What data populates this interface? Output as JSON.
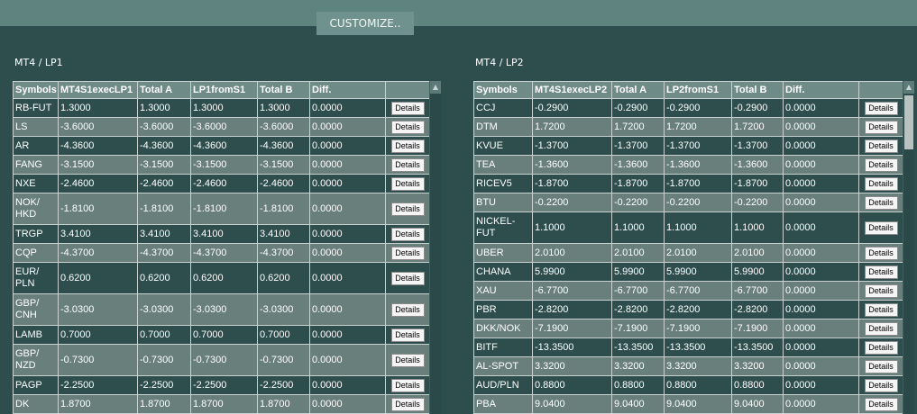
{
  "customize_label": "CUSTOMIZE..",
  "panels": [
    {
      "title": "MT4 / LP1",
      "headers": [
        "Symbols",
        "MT4S1execLP1",
        "Total A",
        "LP1fromS1",
        "Total B",
        "Diff."
      ],
      "button_label": "Details",
      "rows": [
        {
          "symbol": "RB-FUT",
          "exec": "1.3000",
          "total_a": "1.3000",
          "from": "1.3000",
          "total_b": "1.3000",
          "diff": "0.0000"
        },
        {
          "symbol": "LS",
          "exec": "-3.6000",
          "total_a": "-3.6000",
          "from": "-3.6000",
          "total_b": "-3.6000",
          "diff": "0.0000"
        },
        {
          "symbol": "AR",
          "exec": "-4.3600",
          "total_a": "-4.3600",
          "from": "-4.3600",
          "total_b": "-4.3600",
          "diff": "0.0000"
        },
        {
          "symbol": "FANG",
          "exec": "-3.1500",
          "total_a": "-3.1500",
          "from": "-3.1500",
          "total_b": "-3.1500",
          "diff": "0.0000"
        },
        {
          "symbol": "NXE",
          "exec": "-2.4600",
          "total_a": "-2.4600",
          "from": "-2.4600",
          "total_b": "-2.4600",
          "diff": "0.0000"
        },
        {
          "symbol": "NOK/ HKD",
          "exec": "-1.8100",
          "total_a": "-1.8100",
          "from": "-1.8100",
          "total_b": "-1.8100",
          "diff": "0.0000",
          "tall": true
        },
        {
          "symbol": "TRGP",
          "exec": "3.4100",
          "total_a": "3.4100",
          "from": "3.4100",
          "total_b": "3.4100",
          "diff": "0.0000"
        },
        {
          "symbol": "CQP",
          "exec": "-4.3700",
          "total_a": "-4.3700",
          "from": "-4.3700",
          "total_b": "-4.3700",
          "diff": "0.0000"
        },
        {
          "symbol": "EUR/ PLN",
          "exec": "0.6200",
          "total_a": "0.6200",
          "from": "0.6200",
          "total_b": "0.6200",
          "diff": "0.0000",
          "tall": true
        },
        {
          "symbol": "GBP/ CNH",
          "exec": "-3.0300",
          "total_a": "-3.0300",
          "from": "-3.0300",
          "total_b": "-3.0300",
          "diff": "0.0000",
          "tall": true
        },
        {
          "symbol": "LAMB",
          "exec": "0.7000",
          "total_a": "0.7000",
          "from": "0.7000",
          "total_b": "0.7000",
          "diff": "0.0000"
        },
        {
          "symbol": "GBP/ NZD",
          "exec": "-0.7300",
          "total_a": "-0.7300",
          "from": "-0.7300",
          "total_b": "-0.7300",
          "diff": "0.0000",
          "tall": true
        },
        {
          "symbol": "PAGP",
          "exec": "-2.2500",
          "total_a": "-2.2500",
          "from": "-2.2500",
          "total_b": "-2.2500",
          "diff": "0.0000"
        },
        {
          "symbol": "DK",
          "exec": "1.8700",
          "total_a": "1.8700",
          "from": "1.8700",
          "total_b": "1.8700",
          "diff": "0.0000"
        }
      ]
    },
    {
      "title": "MT4 / LP2",
      "headers": [
        "Symbols",
        "MT4S1execLP2",
        "Total A",
        "LP2fromS1",
        "Total B",
        "Diff."
      ],
      "button_label": "Details",
      "rows": [
        {
          "symbol": "CCJ",
          "exec": "-0.2900",
          "total_a": "-0.2900",
          "from": "-0.2900",
          "total_b": "-0.2900",
          "diff": "0.0000"
        },
        {
          "symbol": "DTM",
          "exec": "1.7200",
          "total_a": "1.7200",
          "from": "1.7200",
          "total_b": "1.7200",
          "diff": "0.0000"
        },
        {
          "symbol": "KVUE",
          "exec": "-1.3700",
          "total_a": "-1.3700",
          "from": "-1.3700",
          "total_b": "-1.3700",
          "diff": "0.0000"
        },
        {
          "symbol": "TEA",
          "exec": "-1.3600",
          "total_a": "-1.3600",
          "from": "-1.3600",
          "total_b": "-1.3600",
          "diff": "0.0000"
        },
        {
          "symbol": "RICEV5",
          "exec": "-1.8700",
          "total_a": "-1.8700",
          "from": "-1.8700",
          "total_b": "-1.8700",
          "diff": "0.0000"
        },
        {
          "symbol": "BTU",
          "exec": "-0.2200",
          "total_a": "-0.2200",
          "from": "-0.2200",
          "total_b": "-0.2200",
          "diff": "0.0000"
        },
        {
          "symbol": "NICKEL- FUT",
          "exec": "1.1000",
          "total_a": "1.1000",
          "from": "1.1000",
          "total_b": "1.1000",
          "diff": "0.0000",
          "tall": true
        },
        {
          "symbol": "UBER",
          "exec": "2.0100",
          "total_a": "2.0100",
          "from": "2.0100",
          "total_b": "2.0100",
          "diff": "0.0000"
        },
        {
          "symbol": "CHANA",
          "exec": "5.9900",
          "total_a": "5.9900",
          "from": "5.9900",
          "total_b": "5.9900",
          "diff": "0.0000"
        },
        {
          "symbol": "XAU",
          "exec": "-6.7700",
          "total_a": "-6.7700",
          "from": "-6.7700",
          "total_b": "-6.7700",
          "diff": "0.0000"
        },
        {
          "symbol": "PBR",
          "exec": "-2.8200",
          "total_a": "-2.8200",
          "from": "-2.8200",
          "total_b": "-2.8200",
          "diff": "0.0000"
        },
        {
          "symbol": "DKK/NOK",
          "exec": "-7.1900",
          "total_a": "-7.1900",
          "from": "-7.1900",
          "total_b": "-7.1900",
          "diff": "0.0000"
        },
        {
          "symbol": "BITF",
          "exec": "-13.3500",
          "total_a": "-13.3500",
          "from": "-13.3500",
          "total_b": "-13.3500",
          "diff": "0.0000"
        },
        {
          "symbol": "AL-SPOT",
          "exec": "3.3200",
          "total_a": "3.3200",
          "from": "3.3200",
          "total_b": "3.3200",
          "diff": "0.0000"
        },
        {
          "symbol": "AUD/PLN",
          "exec": "0.8800",
          "total_a": "0.8800",
          "from": "0.8800",
          "total_b": "0.8800",
          "diff": "0.0000"
        },
        {
          "symbol": "PBA",
          "exec": "9.0400",
          "total_a": "9.0400",
          "from": "9.0400",
          "total_b": "9.0400",
          "diff": "0.0000"
        }
      ]
    }
  ],
  "icons": {
    "scroll_up": "chevron-up-icon"
  }
}
